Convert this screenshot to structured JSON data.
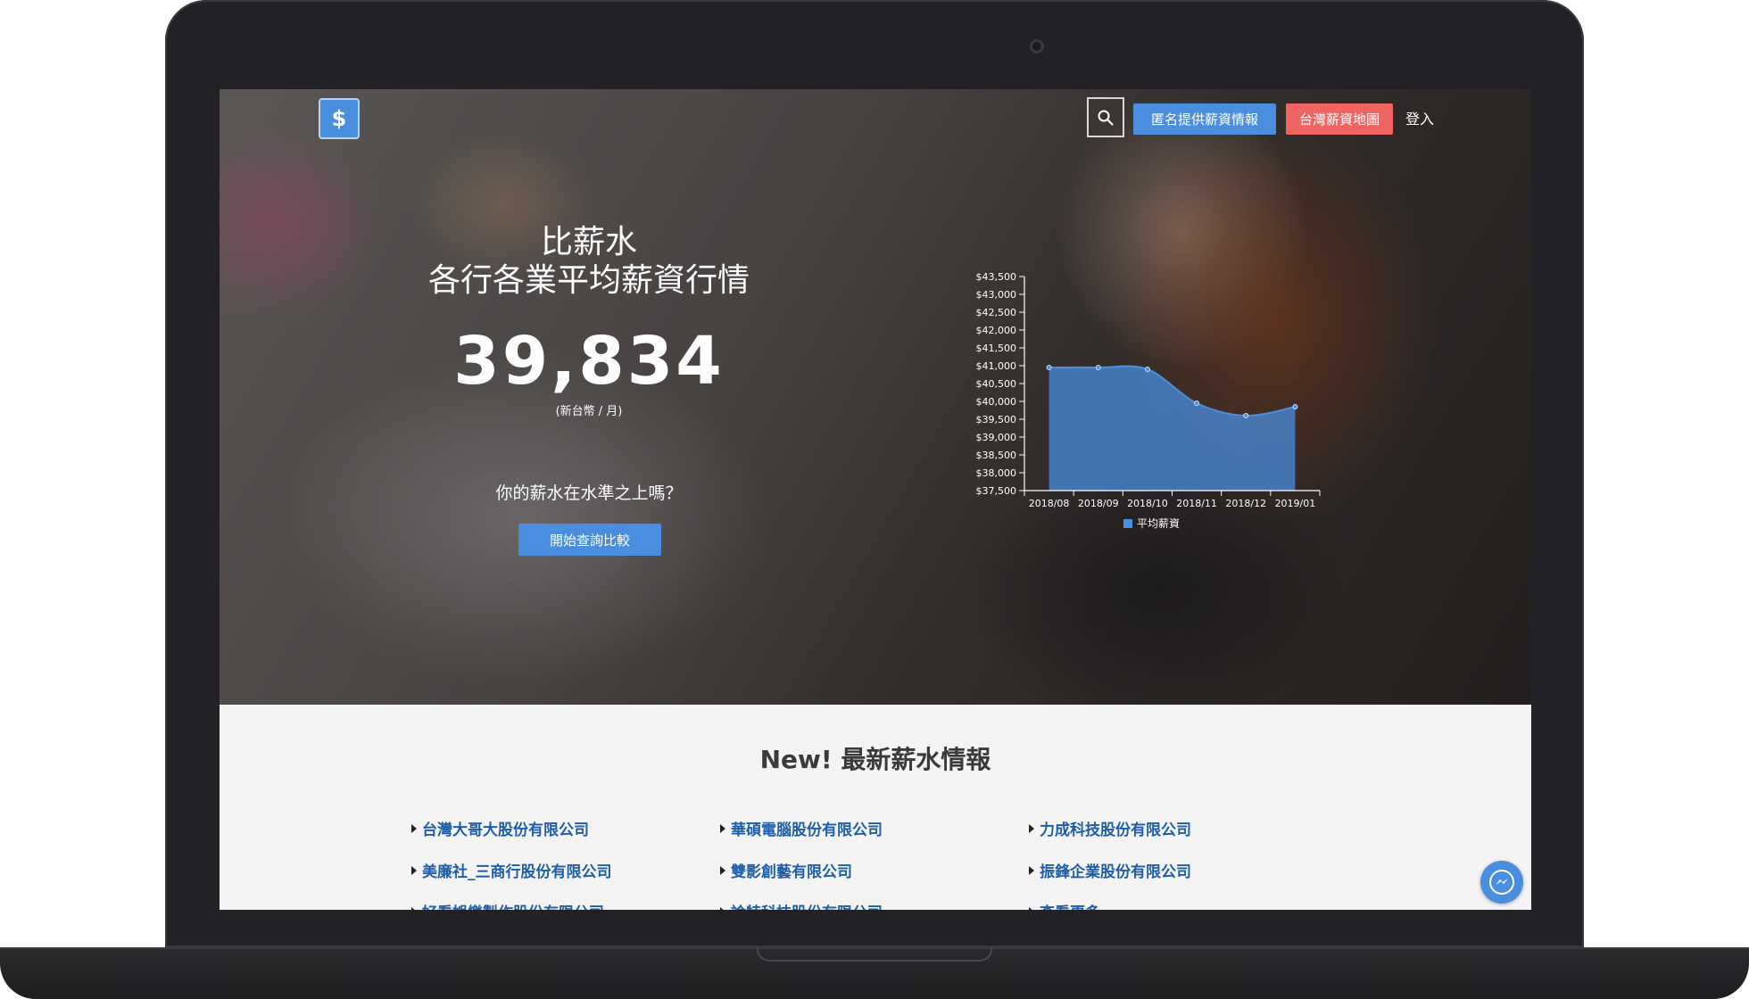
{
  "header": {
    "logo_glyph": "$",
    "anon_label": "匿名提供薪資情報",
    "map_label": "台灣薪資地圖",
    "login_label": "登入"
  },
  "hero": {
    "title_line1": "比薪水",
    "title_line2": "各行各業平均薪資行情",
    "average_value": "39,834",
    "unit": "(新台幣 / 月)",
    "question": "你的薪水在水準之上嗎？",
    "cta_label": "開始查詢比較"
  },
  "chart_data": {
    "type": "area",
    "categories": [
      "2018/08",
      "2018/09",
      "2018/10",
      "2018/11",
      "2018/12",
      "2019/01"
    ],
    "series": [
      {
        "name": "平均薪資",
        "values": [
          40950,
          40950,
          40900,
          39950,
          39600,
          39850
        ]
      }
    ],
    "ylim": [
      37500,
      43500
    ],
    "yticks": [
      "$37,500",
      "$38,000",
      "$38,500",
      "$39,000",
      "$39,500",
      "$40,000",
      "$40,500",
      "$41,000",
      "$41,500",
      "$42,000",
      "$42,500",
      "$43,000",
      "$43,500"
    ],
    "legend": "bottom",
    "color": "#4a8ee0"
  },
  "latest": {
    "title": "New! 最新薪水情報",
    "companies": [
      "台灣大哥大股份有限公司",
      "華碩電腦股份有限公司",
      "力成科技股份有限公司",
      "美廉社_三商行股份有限公司",
      "雙影創藝有限公司",
      "振鋒企業股份有限公司",
      "好看娛樂製作股份有限公司",
      "論特科技股份有限公司",
      "查看更多"
    ]
  }
}
